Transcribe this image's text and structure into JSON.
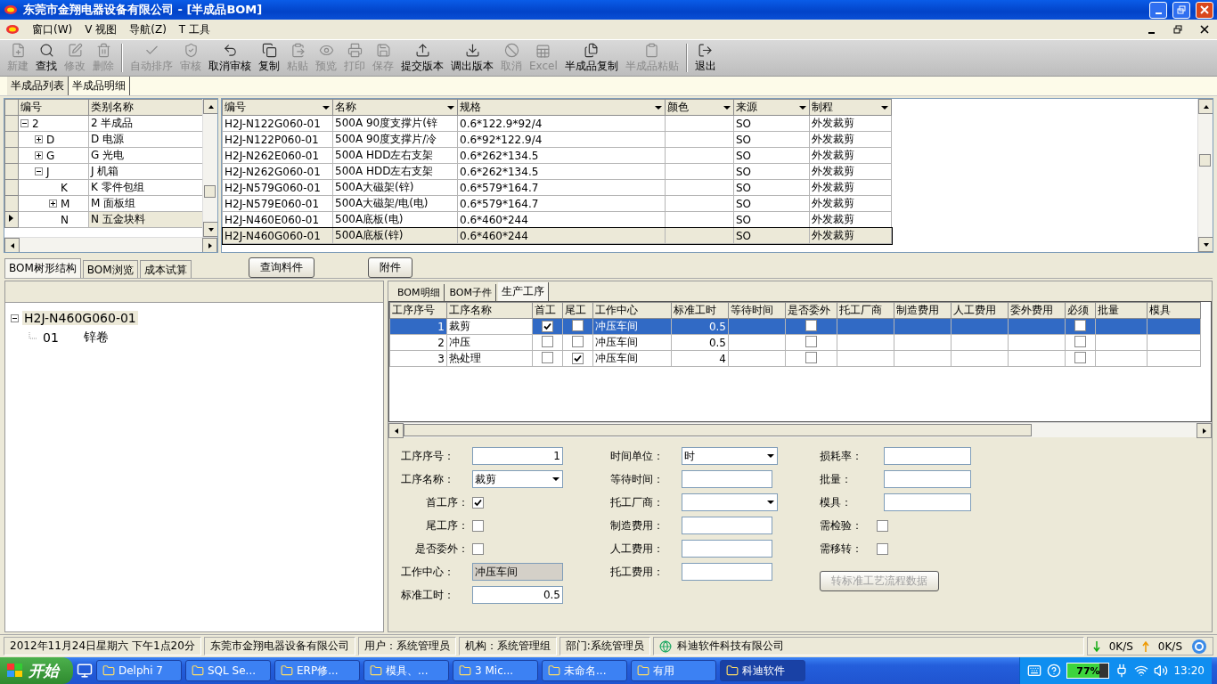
{
  "window": {
    "title": "东莞市金翔电器设备有限公司 - [半成品BOM]"
  },
  "menu": [
    {
      "label": "窗口(W)"
    },
    {
      "label": "V 视图"
    },
    {
      "label": "导航(Z)"
    },
    {
      "label": "T 工具"
    }
  ],
  "toolbar": [
    {
      "kind": "button",
      "label": "新建",
      "disabled": true
    },
    {
      "kind": "button",
      "label": "查找",
      "disabled": false
    },
    {
      "kind": "button",
      "label": "修改",
      "disabled": true
    },
    {
      "kind": "button",
      "label": "删除",
      "disabled": true
    },
    {
      "kind": "separator"
    },
    {
      "kind": "button",
      "label": "自动排序",
      "disabled": true
    },
    {
      "kind": "button",
      "label": "审核",
      "disabled": true
    },
    {
      "kind": "button",
      "label": "取消审核",
      "disabled": false
    },
    {
      "kind": "button",
      "label": "复制",
      "disabled": false
    },
    {
      "kind": "button",
      "label": "粘贴",
      "disabled": true
    },
    {
      "kind": "button",
      "label": "预览",
      "disabled": true
    },
    {
      "kind": "button",
      "label": "打印",
      "disabled": true
    },
    {
      "kind": "button",
      "label": "保存",
      "disabled": true
    },
    {
      "kind": "button",
      "label": "提交版本",
      "disabled": false
    },
    {
      "kind": "button",
      "label": "调出版本",
      "disabled": false
    },
    {
      "kind": "button",
      "label": "取消",
      "disabled": true
    },
    {
      "kind": "button",
      "label": "Excel",
      "disabled": true
    },
    {
      "kind": "button",
      "label": "半成品复制",
      "disabled": false
    },
    {
      "kind": "button",
      "label": "半成品粘贴",
      "disabled": true
    },
    {
      "kind": "separator"
    },
    {
      "kind": "button",
      "label": "退出",
      "disabled": false
    }
  ],
  "top_tabs": [
    {
      "label": "半成品列表",
      "selected": true
    },
    {
      "label": "半成品明细",
      "selected": false
    }
  ],
  "category_tree": {
    "columns": [
      "编号",
      "类别名称"
    ],
    "rows": [
      {
        "code": "2",
        "name": "2 半成品",
        "expanded": true,
        "selected": false,
        "children": [
          {
            "code": "D",
            "name": "D 电源",
            "expanded": false,
            "selected": false
          },
          {
            "code": "G",
            "name": "G 光电",
            "expanded": false,
            "selected": false
          },
          {
            "code": "J",
            "name": "J 机箱",
            "expanded": true,
            "selected": false,
            "children": [
              {
                "code": "K",
                "name": "K 零件包组",
                "selected": false
              },
              {
                "code": "M",
                "name": "M 面板组",
                "expanded": false,
                "selected": false
              },
              {
                "code": "N",
                "name": "N 五金块料",
                "selected": true
              }
            ]
          }
        ]
      }
    ]
  },
  "products": {
    "columns": [
      "编号",
      "名称",
      "规格",
      "颜色",
      "来源",
      "制程"
    ],
    "rows": [
      {
        "cells": [
          "H2J-N122G060-01",
          "500A 90度支撑片(锌",
          "0.6*122.9*92/4",
          "",
          "SO",
          "外发裁剪"
        ],
        "selected": false
      },
      {
        "cells": [
          "H2J-N122P060-01",
          "500A 90度支撑片/冷",
          "0.6*92*122.9/4",
          "",
          "SO",
          "外发裁剪"
        ],
        "selected": false
      },
      {
        "cells": [
          "H2J-N262E060-01",
          "500A HDD左右支架",
          "0.6*262*134.5",
          "",
          "SO",
          "外发裁剪"
        ],
        "selected": false
      },
      {
        "cells": [
          "H2J-N262G060-01",
          "500A HDD左右支架",
          "0.6*262*134.5",
          "",
          "SO",
          "外发裁剪"
        ],
        "selected": false
      },
      {
        "cells": [
          "H2J-N579G060-01",
          "500A大磁架(锌)",
          "0.6*579*164.7",
          "",
          "SO",
          "外发裁剪"
        ],
        "selected": false
      },
      {
        "cells": [
          "H2J-N579E060-01",
          "500A大磁架/电(电)",
          "0.6*579*164.7",
          "",
          "SO",
          "外发裁剪"
        ],
        "selected": false
      },
      {
        "cells": [
          "H2J-N460E060-01",
          "500A底板(电)",
          "0.6*460*244",
          "",
          "SO",
          "外发裁剪"
        ],
        "selected": false
      },
      {
        "cells": [
          "H2J-N460G060-01",
          "500A底板(锌)",
          "0.6*460*244",
          "",
          "SO",
          "外发裁剪"
        ],
        "selected": true
      }
    ]
  },
  "bottom_tabs": [
    {
      "label": "BOM树形结构",
      "selected": true
    },
    {
      "label": "BOM浏览",
      "selected": false
    },
    {
      "label": "成本试算",
      "selected": false
    }
  ],
  "bottom_buttons": [
    "查询料件",
    "附件"
  ],
  "bom_tree": {
    "label": "H2J-N460G060-01",
    "expanded": true,
    "children": [
      {
        "code": "01",
        "name": "锌卷"
      }
    ]
  },
  "detail_tabs": [
    {
      "label": "BOM明细",
      "selected": false
    },
    {
      "label": "BOM子件",
      "selected": false
    },
    {
      "label": "生产工序",
      "selected": true
    }
  ],
  "process_grid": {
    "columns": [
      "工序序号",
      "工序名称",
      "首工",
      "尾工",
      "工作中心",
      "标准工时",
      "等待时间",
      "是否委外",
      "托工厂商",
      "制造费用",
      "人工费用",
      "委外费用",
      "必须",
      "批量",
      "模具"
    ],
    "rows": [
      {
        "seq": "1",
        "name": "裁剪",
        "first": true,
        "last": false,
        "center": "冲压车间",
        "std_time": "0.5",
        "outsource": false,
        "must": false,
        "selected": true
      },
      {
        "seq": "2",
        "name": "冲压",
        "first": false,
        "last": false,
        "center": "冲压车间",
        "std_time": "0.5",
        "outsource": false,
        "must": false,
        "selected": false
      },
      {
        "seq": "3",
        "name": "热处理",
        "first": false,
        "last": true,
        "center": "冲压车间",
        "std_time": "4",
        "outsource": false,
        "must": false,
        "selected": false
      }
    ]
  },
  "form": {
    "columns": [
      [
        {
          "kind": "input",
          "label": "工序序号：",
          "value": "1"
        },
        {
          "kind": "select",
          "label": "工序名称：",
          "value": "裁剪"
        },
        {
          "kind": "checkbox",
          "label": "首工序：",
          "checked": true
        },
        {
          "kind": "checkbox",
          "label": "尾工序：",
          "checked": false
        },
        {
          "kind": "checkbox",
          "label": "是否委外：",
          "checked": false
        },
        {
          "kind": "readonly",
          "label": "工作中心：",
          "value": "冲压车间"
        },
        {
          "kind": "input",
          "label": "标准工时：",
          "value": "0.5"
        }
      ],
      [
        {
          "kind": "select",
          "label": "时间单位：",
          "value": "时"
        },
        {
          "kind": "input",
          "label": "等待时间："
        },
        {
          "kind": "select",
          "label": "托工厂商："
        },
        {
          "kind": "input",
          "label": "制造费用："
        },
        {
          "kind": "input",
          "label": "人工费用："
        },
        {
          "kind": "input",
          "label": "托工费用："
        }
      ],
      [
        {
          "kind": "input",
          "label": "损耗率："
        },
        {
          "kind": "input",
          "label": "批量："
        },
        {
          "kind": "input",
          "label": "模具："
        },
        {
          "kind": "checkbox",
          "label": "需检验：",
          "checked": false
        },
        {
          "kind": "checkbox",
          "label": "需移转：",
          "checked": false
        },
        {
          "kind": "button",
          "label": "转标准工艺流程数据",
          "disabled": true
        }
      ]
    ]
  },
  "status_bar": [
    "2012年11月24日星期六 下午1点20分",
    "东莞市金翔电器设备有限公司",
    "用户：系统管理员",
    "机构：系统管理组",
    "部门:系统管理员",
    "科迪软件科技有限公司"
  ],
  "net_meter": {
    "down": "0K/S",
    "up": "0K/S"
  },
  "taskbar": {
    "start": "开始",
    "tasks": [
      {
        "label": "Delphi 7",
        "selected": false
      },
      {
        "label": "SQL Se...",
        "selected": false
      },
      {
        "label": "ERP修...",
        "selected": false
      },
      {
        "label": "模具、...",
        "selected": false
      },
      {
        "label": "3 Mic...",
        "selected": false
      },
      {
        "label": "未命名...",
        "selected": false
      },
      {
        "label": "有用",
        "selected": false
      },
      {
        "label": "科迪软件",
        "selected": true
      }
    ],
    "battery": {
      "label": "77%",
      "level": 0.77
    },
    "clock": "13:20"
  }
}
